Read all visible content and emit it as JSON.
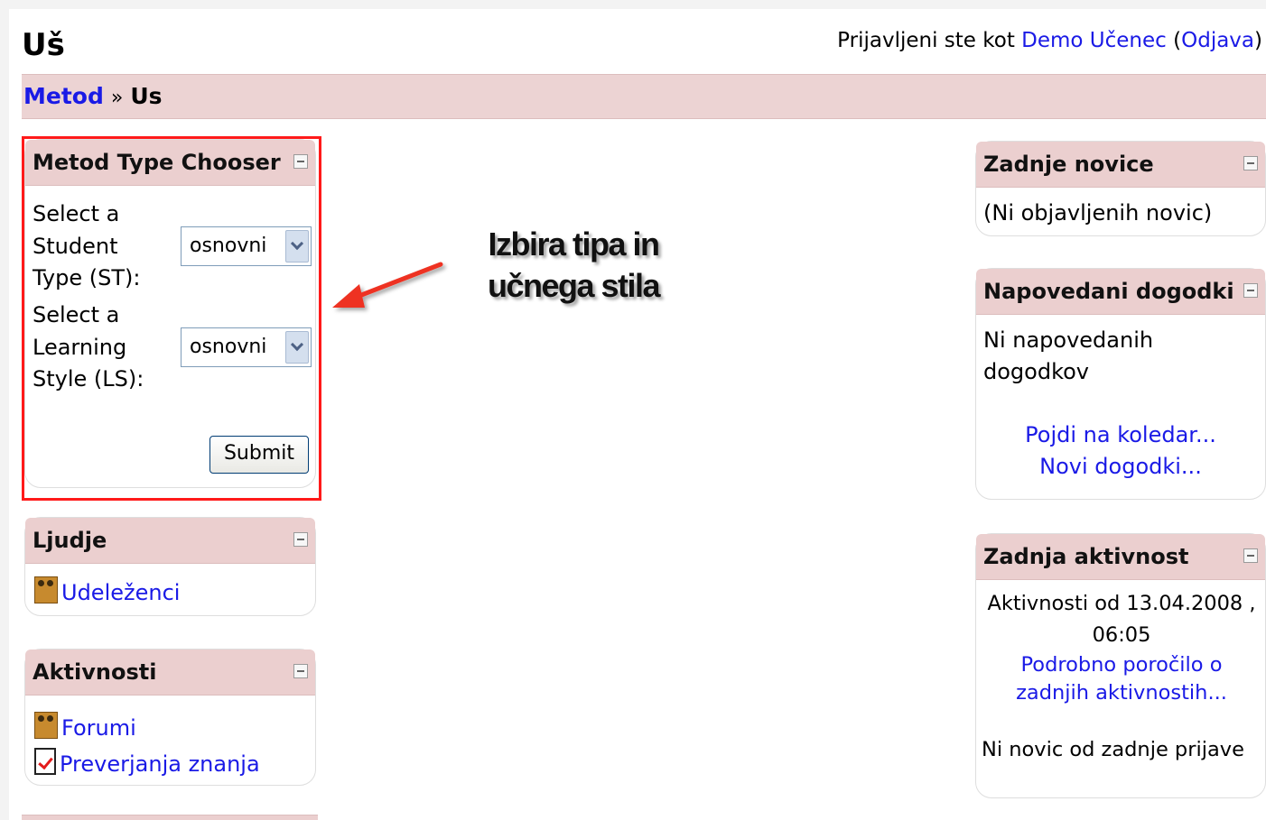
{
  "header": {
    "site_title": "Uš",
    "login_prefix": "Prijavljeni ste kot",
    "user_name": "Demo Učenec",
    "logout_open": "(",
    "logout_label": "Odjava",
    "logout_close": ")"
  },
  "breadcrumb": {
    "root_link": "Metod",
    "separator": "»",
    "current": "Us"
  },
  "chooser_block": {
    "title": "Metod Type Chooser",
    "student_type_label": "Select a Student Type (ST):",
    "student_type_value": "osnovni",
    "learning_style_label": "Select a Learning Style (LS):",
    "learning_style_value": "osnovni",
    "submit_label": "Submit"
  },
  "annotation": {
    "text_line1": "Izbira tipa in",
    "text_line2": "učnega stila"
  },
  "people_block": {
    "title": "Ljudje",
    "items": [
      {
        "label": "Udeleženci",
        "icon": "participants-icon"
      }
    ]
  },
  "activities_block": {
    "title": "Aktivnosti",
    "items": [
      {
        "label": "Forumi",
        "icon": "forum-icon"
      },
      {
        "label": "Preverjanja znanja",
        "icon": "quiz-icon"
      }
    ]
  },
  "news_block": {
    "title": "Zadnje novice",
    "empty_text": "(Ni objavljenih novic)"
  },
  "events_block": {
    "title": "Napovedani dogodki",
    "empty_text": "Ni napovedanih dogodkov",
    "calendar_link": "Pojdi na koledar...",
    "new_event_link": "Novi dogodki..."
  },
  "recent_activity_block": {
    "title": "Zadnja aktivnost",
    "since_text_line1": "Aktivnosti od 13.04.2008 ,",
    "since_text_line2": "06:05",
    "report_link": "Podrobno poročilo o zadnjih aktivnostih...",
    "no_news_text": "Ni novic od zadnje prijave"
  },
  "colors": {
    "header_bar": "#ecd3d3",
    "link": "#1a1ae6",
    "highlight": "#ff1a1a"
  }
}
